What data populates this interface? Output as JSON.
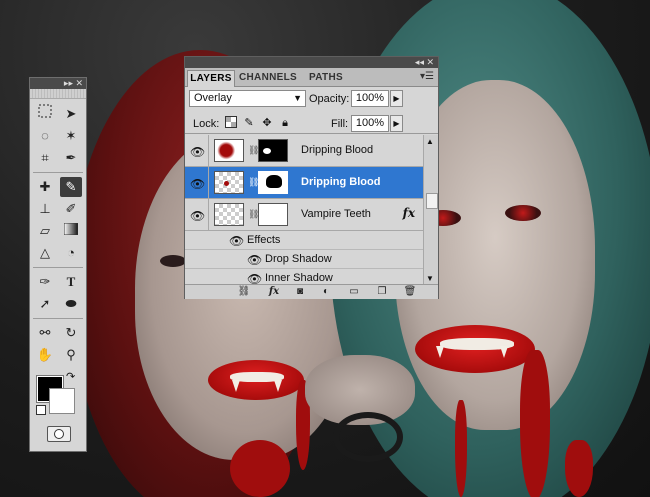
{
  "tools_panel": {
    "header_glyphs": "▸▸ ✕"
  },
  "layers_panel": {
    "header_glyphs": "◂◂ ✕",
    "tabs": [
      {
        "label": "LAYERS",
        "active": true
      },
      {
        "label": "CHANNELS",
        "active": false
      },
      {
        "label": "PATHS",
        "active": false
      }
    ],
    "blend_mode": "Overlay",
    "opacity_label": "Opacity:",
    "opacity_value": "100%",
    "lock_label": "Lock:",
    "fill_label": "Fill:",
    "fill_value": "100%",
    "layers": [
      {
        "name": "Dripping Blood",
        "selected": false
      },
      {
        "name": "Dripping Blood",
        "selected": true
      },
      {
        "name": "Vampire Teeth",
        "selected": false,
        "fx": "fx"
      }
    ],
    "effects_label": "Effects",
    "effects": [
      "Drop Shadow",
      "Inner Shadow"
    ]
  },
  "colors": {
    "selection": "#2f77d0",
    "panel_bg": "#d6d6d6",
    "foreground": "#000000",
    "background": "#ffffff"
  }
}
